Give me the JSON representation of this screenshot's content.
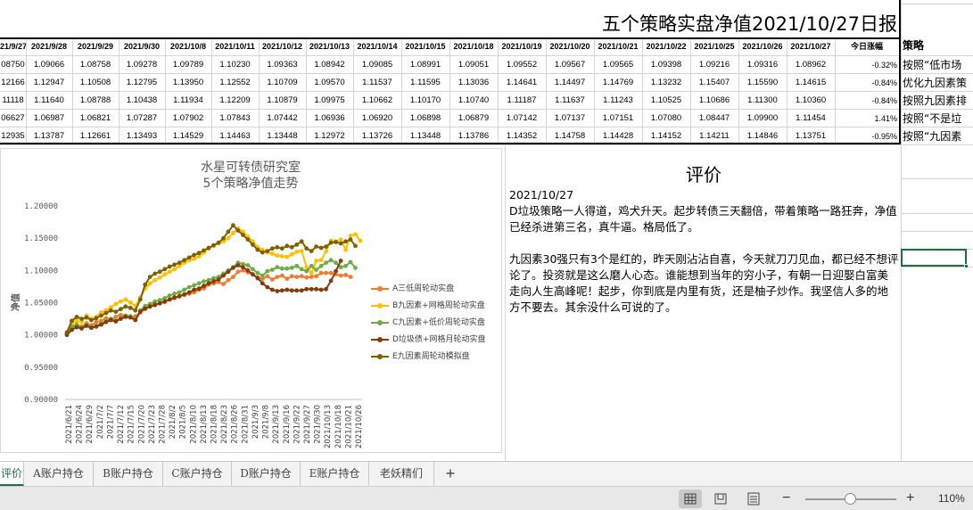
{
  "title": "五个策略实盘净值2021/10/27日报",
  "strategy_header": "策略",
  "date_headers": [
    "21/9/27",
    "2021/9/28",
    "2021/9/29",
    "2021/9/30",
    "2021/10/8",
    "2021/10/11",
    "2021/10/12",
    "2021/10/13",
    "2021/10/14",
    "2021/10/15",
    "2021/10/18",
    "2021/10/19",
    "2021/10/20",
    "2021/10/21",
    "2021/10/22",
    "2021/10/25",
    "2021/10/26",
    "2021/10/27",
    "今日涨幅"
  ],
  "rows": [
    {
      "values": [
        "08750",
        "1.09066",
        "1.08758",
        "1.09278",
        "1.09789",
        "1.10230",
        "1.09363",
        "1.08942",
        "1.09085",
        "1.08991",
        "1.09051",
        "1.09552",
        "1.09567",
        "1.09565",
        "1.09398",
        "1.09216",
        "1.09316",
        "1.08962",
        "-0.32%"
      ],
      "strategy": "按照“低市场"
    },
    {
      "values": [
        "12166",
        "1.12947",
        "1.10508",
        "1.12795",
        "1.13950",
        "1.12552",
        "1.10709",
        "1.09570",
        "1.11537",
        "1.11595",
        "1.13036",
        "1.14641",
        "1.14497",
        "1.14769",
        "1.13232",
        "1.15407",
        "1.15590",
        "1.14615",
        "-0.84%"
      ],
      "strategy": "优化九因素策"
    },
    {
      "values": [
        "11118",
        "1.11640",
        "1.08788",
        "1.10438",
        "1.11934",
        "1.12209",
        "1.10879",
        "1.09975",
        "1.10662",
        "1.10170",
        "1.10740",
        "1.11187",
        "1.11637",
        "1.11243",
        "1.10525",
        "1.10686",
        "1.11300",
        "1.10360",
        "-0.84%"
      ],
      "strategy": "按照九因素排"
    },
    {
      "values": [
        "06627",
        "1.06987",
        "1.06821",
        "1.07287",
        "1.07902",
        "1.07843",
        "1.07442",
        "1.06936",
        "1.06920",
        "1.06898",
        "1.06879",
        "1.07142",
        "1.07137",
        "1.07151",
        "1.07080",
        "1.08447",
        "1.09900",
        "1.11454",
        "1.41%"
      ],
      "strategy": "按照“不是垃"
    },
    {
      "values": [
        "12935",
        "1.13787",
        "1.12661",
        "1.13493",
        "1.14529",
        "1.14463",
        "1.13448",
        "1.12972",
        "1.13726",
        "1.13448",
        "1.13786",
        "1.14352",
        "1.14758",
        "1.14428",
        "1.14152",
        "1.14211",
        "1.14846",
        "1.13751",
        "-0.95%"
      ],
      "strategy": "按照“九因素"
    }
  ],
  "review": {
    "title": "评价",
    "date": "2021/10/27",
    "paragraph1": "D垃圾策略一人得道，鸡犬升天。起步转债三天翻倍，带着策略一路狂奔，净值已经杀进第三名，真牛逼。格局低了。",
    "paragraph2": "九因素30强只有3个是红的，昨天刚沾沾自喜，今天就刀刀见血，都已经不想评论了。投资就是这么磨人心态。谁能想到当年的穷小子，有朝一日迎娶白富美走向人生高峰呢！起步，你到底是内里有货，还是柚子炒作。我坚信人多的地方不要去。其余没什么可说的了。"
  },
  "tabs": [
    "评价",
    "A账户持仓",
    "B账户持仓",
    "C账户持仓",
    "D账户持仓",
    "E账户持仓",
    "老妖精们"
  ],
  "active_tab_display": "评价",
  "status": {
    "zoom": "110%",
    "zoom_minus": "−",
    "zoom_plus": "+",
    "add_sheet": "+"
  },
  "colors": {
    "A": "#ed7d31",
    "B": "#ffc000",
    "C": "#70ad47",
    "D": "#843c0c",
    "E": "#7f6000",
    "accent": "#1e7145"
  },
  "chart_data": {
    "type": "line",
    "title": "水星可转债研究室",
    "subtitle": "5个策略净值走势",
    "ylabel": "净值",
    "xlabel": "",
    "ylim": [
      0.9,
      1.2
    ],
    "yticks": [
      "1.20000",
      "1.15000",
      "1.10000",
      "1.05000",
      "1.00000",
      "0.95000",
      "0.90000"
    ],
    "x_tick_labels": [
      "2021/6/21",
      "2021/6/24",
      "2021/6/29",
      "2021/7/2",
      "2021/7/7",
      "2021/7/12",
      "2021/7/15",
      "2021/7/20",
      "2021/7/23",
      "2021/7/28",
      "2021/8/2",
      "2021/8/5",
      "2021/8/10",
      "2021/8/13",
      "2021/8/18",
      "2021/8/23",
      "2021/8/26",
      "2021/8/31",
      "2021/9/3",
      "2021/9/8",
      "2021/9/13",
      "2021/9/16",
      "2021/9/22",
      "2021/9/27",
      "2021/9/30",
      "2021/10/13",
      "2021/10/18",
      "2021/10/21",
      "2021/10/26"
    ],
    "grid": false,
    "legend_position": "right",
    "series": [
      {
        "name": "A三低周轮动实盘",
        "color": "#ed7d31",
        "values": [
          1.002,
          1.012,
          1.016,
          1.013,
          1.018,
          1.015,
          1.02,
          1.022,
          1.026,
          1.024,
          1.028,
          1.031,
          1.03,
          1.027,
          1.029,
          1.035,
          1.04,
          1.044,
          1.046,
          1.049,
          1.051,
          1.055,
          1.057,
          1.06,
          1.062,
          1.064,
          1.066,
          1.07,
          1.072,
          1.078,
          1.08,
          1.082,
          1.079,
          1.085,
          1.09,
          1.098,
          1.1,
          1.097,
          1.094,
          1.089,
          1.087,
          1.091,
          1.086,
          1.09,
          1.092,
          1.087,
          1.091,
          1.09,
          1.091,
          1.089,
          1.09,
          1.091,
          1.096,
          1.096,
          1.096,
          1.094,
          1.092,
          1.093,
          1.09
        ]
      },
      {
        "name": "B九因素+网格周轮动实盘",
        "color": "#ffc000",
        "values": [
          1.003,
          1.018,
          1.022,
          1.02,
          1.03,
          1.025,
          1.028,
          1.035,
          1.038,
          1.043,
          1.048,
          1.052,
          1.055,
          1.05,
          1.045,
          1.058,
          1.072,
          1.08,
          1.085,
          1.089,
          1.094,
          1.098,
          1.102,
          1.107,
          1.112,
          1.116,
          1.118,
          1.122,
          1.128,
          1.134,
          1.138,
          1.142,
          1.145,
          1.15,
          1.158,
          1.165,
          1.16,
          1.152,
          1.145,
          1.136,
          1.132,
          1.128,
          1.126,
          1.123,
          1.122,
          1.121,
          1.125,
          1.129,
          1.13,
          1.105,
          1.096,
          1.115,
          1.116,
          1.13,
          1.146,
          1.145,
          1.148,
          1.132,
          1.154,
          1.156,
          1.146
        ]
      },
      {
        "name": "C九因素+低价周轮动实盘",
        "color": "#70ad47",
        "values": [
          1.001,
          1.013,
          1.016,
          1.012,
          1.015,
          1.012,
          1.014,
          1.018,
          1.021,
          1.025,
          1.022,
          1.026,
          1.03,
          1.029,
          1.024,
          1.038,
          1.045,
          1.048,
          1.052,
          1.054,
          1.057,
          1.061,
          1.064,
          1.066,
          1.07,
          1.074,
          1.077,
          1.08,
          1.083,
          1.085,
          1.088,
          1.09,
          1.095,
          1.1,
          1.105,
          1.112,
          1.11,
          1.108,
          1.102,
          1.096,
          1.092,
          1.099,
          1.101,
          1.105,
          1.103,
          1.103,
          1.104,
          1.107,
          1.102,
          1.099,
          1.107,
          1.101,
          1.107,
          1.112,
          1.116,
          1.112,
          1.105,
          1.107,
          1.113,
          1.104
        ]
      },
      {
        "name": "D垃圾债+网格月轮动实盘",
        "color": "#843c0c",
        "values": [
          1.0,
          1.008,
          1.012,
          1.01,
          1.014,
          1.011,
          1.013,
          1.016,
          1.02,
          1.023,
          1.021,
          1.025,
          1.028,
          1.027,
          1.023,
          1.036,
          1.041,
          1.044,
          1.047,
          1.049,
          1.052,
          1.055,
          1.058,
          1.06,
          1.063,
          1.066,
          1.07,
          1.072,
          1.076,
          1.08,
          1.083,
          1.086,
          1.092,
          1.098,
          1.104,
          1.108,
          1.105,
          1.1,
          1.094,
          1.088,
          1.08,
          1.074,
          1.07,
          1.068,
          1.069,
          1.07,
          1.069,
          1.069,
          1.069,
          1.071,
          1.071,
          1.071,
          1.07,
          1.071,
          1.084,
          1.099,
          1.115
        ]
      },
      {
        "name": "E九因素周轮动模拟盘",
        "color": "#7f6000",
        "values": [
          1.004,
          1.022,
          1.028,
          1.025,
          1.027,
          1.023,
          1.026,
          1.03,
          1.034,
          1.038,
          1.036,
          1.04,
          1.044,
          1.042,
          1.038,
          1.055,
          1.078,
          1.09,
          1.095,
          1.098,
          1.102,
          1.106,
          1.109,
          1.112,
          1.116,
          1.12,
          1.124,
          1.127,
          1.131,
          1.135,
          1.139,
          1.143,
          1.15,
          1.16,
          1.17,
          1.162,
          1.155,
          1.148,
          1.14,
          1.132,
          1.128,
          1.13,
          1.134,
          1.136,
          1.134,
          1.138,
          1.136,
          1.14,
          1.145,
          1.134,
          1.13,
          1.137,
          1.135,
          1.137,
          1.143,
          1.144,
          1.142,
          1.145,
          1.148,
          1.138
        ]
      }
    ]
  }
}
